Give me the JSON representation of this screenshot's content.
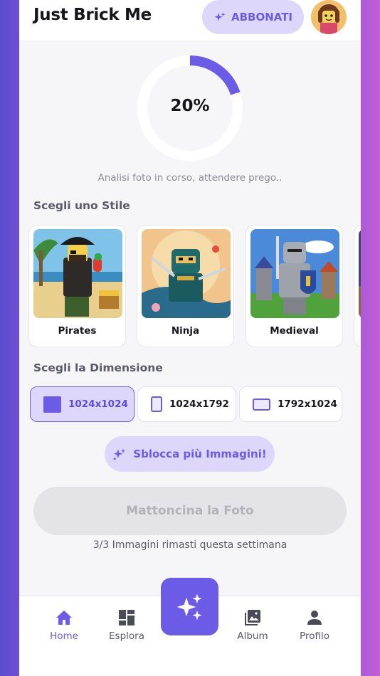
{
  "header": {
    "title": "Just Brick Me",
    "subscribe_label": "ABBONATI",
    "subscribe_icon": "sparkles-icon",
    "avatar_icon": "avatar"
  },
  "progress": {
    "value_label": "20%",
    "fraction": 0.2,
    "status": "Analisi foto in corso, attendere prego.."
  },
  "style_section": {
    "title": "Scegli uno Stile",
    "cards": [
      {
        "label": "Pirates"
      },
      {
        "label": "Ninja"
      },
      {
        "label": "Medieval"
      }
    ]
  },
  "size_section": {
    "title": "Scegli la Dimensione",
    "options": [
      {
        "label": "1024x1024",
        "selected": true
      },
      {
        "label": "1024x1792",
        "selected": false
      },
      {
        "label": "1792x1024",
        "selected": false
      }
    ]
  },
  "unlock_label": "Sblocca più Immagini!",
  "generate_label": "Mattoncina la Foto",
  "remaining_text": "3/3 Immagini rimasti questa settimana",
  "nav": {
    "items": [
      {
        "label": "Home",
        "icon": "home-icon",
        "active": true
      },
      {
        "label": "Esplora",
        "icon": "grid-icon",
        "active": false
      },
      {
        "label": "Album",
        "icon": "photos-icon",
        "active": false
      },
      {
        "label": "Profilo",
        "icon": "person-icon",
        "active": false
      }
    ],
    "center_icon": "sparkles-icon"
  },
  "colors": {
    "accent": "#6b5be6",
    "accent_light": "#ddd8fb",
    "background": "#f6f6f8"
  }
}
